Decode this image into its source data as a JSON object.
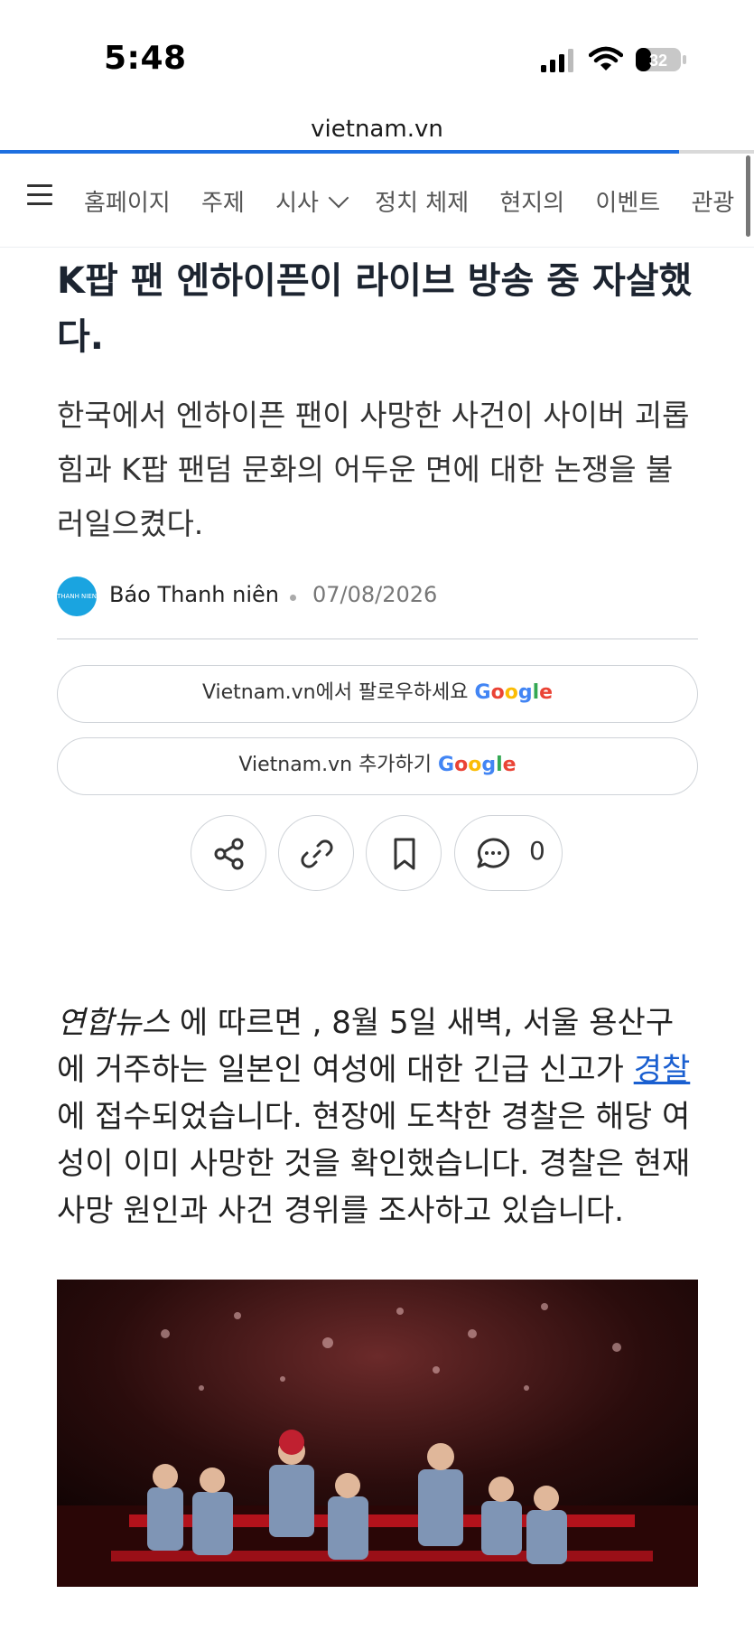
{
  "status_bar": {
    "time": "5:48",
    "battery": "32",
    "icons": [
      "cellular-signal-icon",
      "wifi-icon",
      "battery-icon"
    ]
  },
  "browser": {
    "url": "vietnam.vn",
    "load_progress": 0.9
  },
  "nav": {
    "items": [
      "홈페이지",
      "주제",
      "시사",
      "정치 체제",
      "현지의",
      "이벤트",
      "관광"
    ],
    "icons": [
      "menu-icon",
      "chevron-down-icon"
    ]
  },
  "article": {
    "title": "K팝 팬 엔하이픈이 라이브 방송 중 자살했다.",
    "subtitle": "한국에서 엔하이픈 팬이 사망한 사건이 사이버 괴롭힘과 K팝 팬덤 문화의 어두운 면에 대한 논쟁을 불러일으켰다.",
    "source": "Báo Thanh niên",
    "date": "07/08/2026",
    "follow_label": "Vietnam.vn에서 팔로우하세요",
    "add_label": "Vietnam.vn 추가하기",
    "google_letters": [
      "G",
      "o",
      "o",
      "g",
      "l",
      "e"
    ],
    "comment_count": "0",
    "action_icons": [
      "share-icon",
      "link-icon",
      "bookmark-icon",
      "comment-icon"
    ],
    "body": {
      "source_em": "연합뉴스",
      "part1": " 에 따르면 , 8월 5일 새벽, 서울 용산구에 거주하는 일본인 여성에 대한 긴급 신고가 ",
      "link": "경찰",
      "part2": " 에 접수되었습니다. 현장에 도착한 경찰은 해당 여성이 이미 사망한 것을 확인했습니다. 경찰은 현재 사망 원인과 사건 경위를 조사하고 있습니다."
    }
  },
  "colors": {
    "accent": "#1e6fe0",
    "google_blue": "#4285F4",
    "google_red": "#EA4335",
    "google_yellow": "#FBBC05",
    "google_green": "#34A853"
  }
}
